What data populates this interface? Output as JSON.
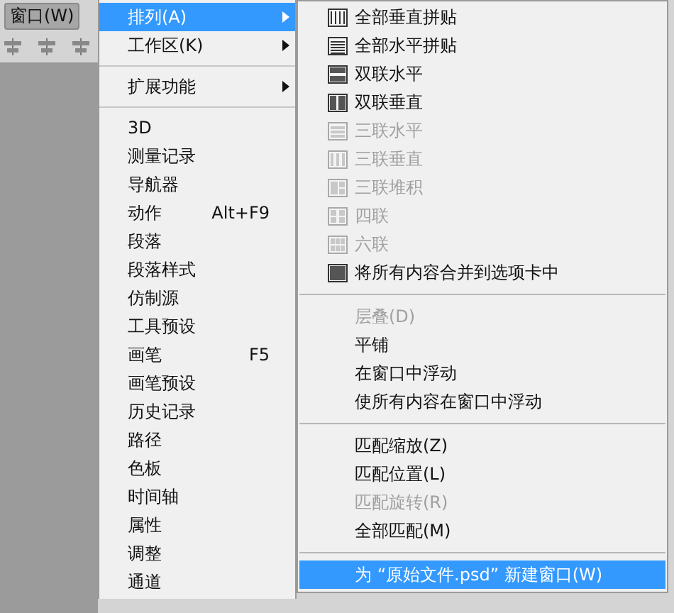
{
  "toolbar": {
    "menu_button": "窗口(W)"
  },
  "window_menu": {
    "sections": [
      {
        "items": [
          {
            "label": "排列(A)",
            "submenu": true,
            "selected": true
          },
          {
            "label": "工作区(K)",
            "submenu": true,
            "selected": false
          }
        ]
      },
      {
        "items": [
          {
            "label": "扩展功能",
            "submenu": true,
            "selected": false
          }
        ]
      },
      {
        "items": [
          {
            "label": "3D",
            "submenu": false,
            "selected": false
          },
          {
            "label": "测量记录",
            "submenu": false,
            "selected": false
          },
          {
            "label": "导航器",
            "submenu": false,
            "selected": false
          },
          {
            "label": "动作",
            "shortcut": "Alt+F9",
            "submenu": false,
            "selected": false
          },
          {
            "label": "段落",
            "submenu": false,
            "selected": false
          },
          {
            "label": "段落样式",
            "submenu": false,
            "selected": false
          },
          {
            "label": "仿制源",
            "submenu": false,
            "selected": false
          },
          {
            "label": "工具预设",
            "submenu": false,
            "selected": false
          },
          {
            "label": "画笔",
            "shortcut": "F5",
            "submenu": false,
            "selected": false
          },
          {
            "label": "画笔预设",
            "submenu": false,
            "selected": false
          },
          {
            "label": "历史记录",
            "submenu": false,
            "selected": false
          },
          {
            "label": "路径",
            "submenu": false,
            "selected": false
          },
          {
            "label": "色板",
            "submenu": false,
            "selected": false
          },
          {
            "label": "时间轴",
            "submenu": false,
            "selected": false
          },
          {
            "label": "属性",
            "submenu": false,
            "selected": false
          },
          {
            "label": "调整",
            "submenu": false,
            "selected": false
          },
          {
            "label": "通道",
            "submenu": false,
            "selected": false
          }
        ]
      }
    ]
  },
  "arrange_submenu": {
    "sections": [
      {
        "items": [
          {
            "label": "全部垂直拼贴",
            "kind": "cols4",
            "disabled": false,
            "selected": false
          },
          {
            "label": "全部水平拼贴",
            "kind": "rows",
            "disabled": false,
            "selected": false
          },
          {
            "label": "双联水平",
            "kind": "h2",
            "disabled": false,
            "selected": false
          },
          {
            "label": "双联垂直",
            "kind": "v2",
            "disabled": false,
            "selected": false
          },
          {
            "label": "三联水平",
            "kind": "h3",
            "disabled": true,
            "selected": false
          },
          {
            "label": "三联垂直",
            "kind": "v3",
            "disabled": true,
            "selected": false
          },
          {
            "label": "三联堆积",
            "kind": "stack3",
            "disabled": true,
            "selected": false
          },
          {
            "label": "四联",
            "kind": "quad",
            "disabled": true,
            "selected": false
          },
          {
            "label": "六联",
            "kind": "six",
            "disabled": true,
            "selected": false
          },
          {
            "label": "将所有内容合并到选项卡中",
            "kind": "full",
            "disabled": false,
            "selected": false
          }
        ]
      },
      {
        "items": [
          {
            "label": "层叠(D)",
            "disabled": true,
            "selected": false
          },
          {
            "label": "平铺",
            "disabled": false,
            "selected": false
          },
          {
            "label": "在窗口中浮动",
            "disabled": false,
            "selected": false
          },
          {
            "label": "使所有内容在窗口中浮动",
            "disabled": false,
            "selected": false
          }
        ]
      },
      {
        "items": [
          {
            "label": "匹配缩放(Z)",
            "disabled": false,
            "selected": false
          },
          {
            "label": "匹配位置(L)",
            "disabled": false,
            "selected": false
          },
          {
            "label": "匹配旋转(R)",
            "disabled": true,
            "selected": false
          },
          {
            "label": "全部匹配(M)",
            "disabled": false,
            "selected": false
          }
        ]
      },
      {
        "items": [
          {
            "label": "为 “原始文件.psd” 新建窗口(W)",
            "disabled": false,
            "selected": true
          }
        ]
      }
    ]
  }
}
